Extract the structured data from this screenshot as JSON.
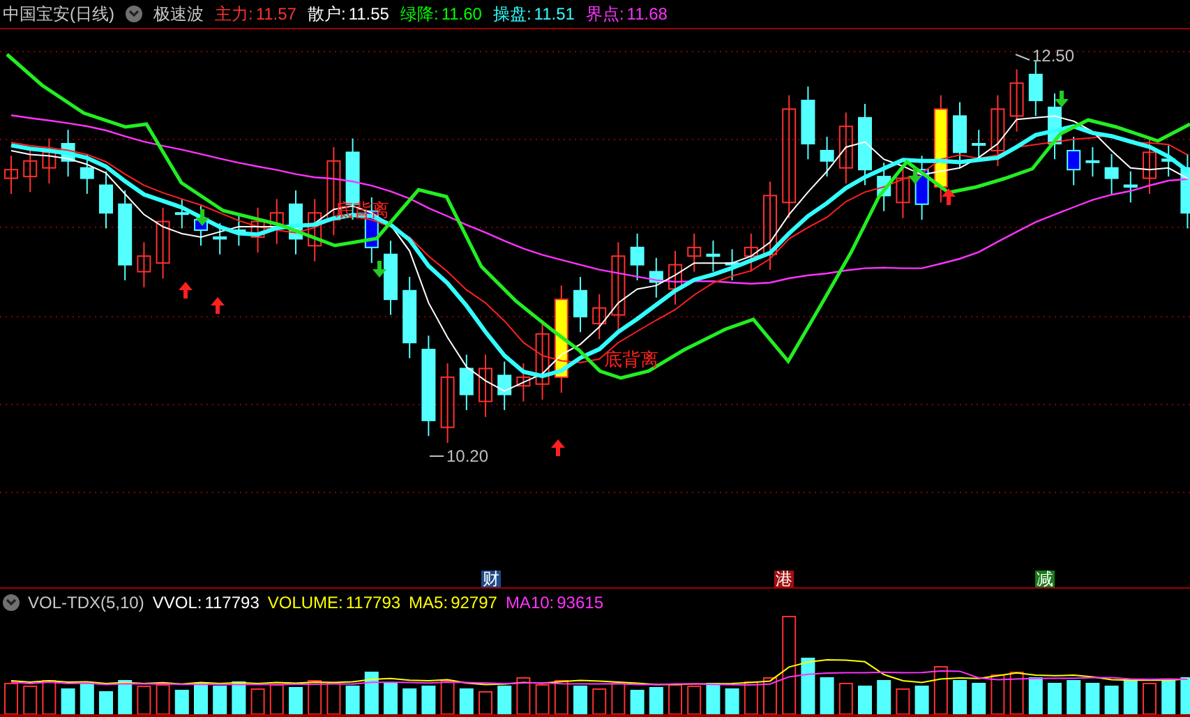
{
  "title": "中国宝安(日线)",
  "indicator": "极速波",
  "legend": [
    {
      "label": "主力:",
      "value": "11.57",
      "color": "#ff3232"
    },
    {
      "label": "散户:",
      "value": "11.55",
      "color": "#ffffff"
    },
    {
      "label": "绿降:",
      "value": "11.60",
      "color": "#00ff00"
    },
    {
      "label": "操盘:",
      "value": "11.51",
      "color": "#33ffff"
    },
    {
      "label": "界点:",
      "value": "11.68",
      "color": "#ff33ff"
    }
  ],
  "chart_labels": [
    {
      "kind": "divergence",
      "text": "底背离"
    },
    {
      "kind": "divergence",
      "text": "底背离"
    },
    {
      "kind": "high",
      "text": "12.50"
    },
    {
      "kind": "low",
      "text": "10.20"
    }
  ],
  "events": [
    {
      "text": "财",
      "color": "#1e4a8a"
    },
    {
      "text": "港",
      "color": "#a01010"
    },
    {
      "text": "减",
      "color": "#1a7a1a"
    }
  ],
  "volume_legend": {
    "name": "VOL-TDX(5,10)",
    "items": [
      {
        "label": "VVOL:",
        "value": "117793",
        "color": "#ffffff"
      },
      {
        "label": "VOLUME:",
        "value": "117793",
        "color": "#ffff00"
      },
      {
        "label": "MA5:",
        "value": "92797",
        "color": "#ffff00"
      },
      {
        "label": "MA10:",
        "value": "93615",
        "color": "#ff33ff"
      }
    ]
  }
}
